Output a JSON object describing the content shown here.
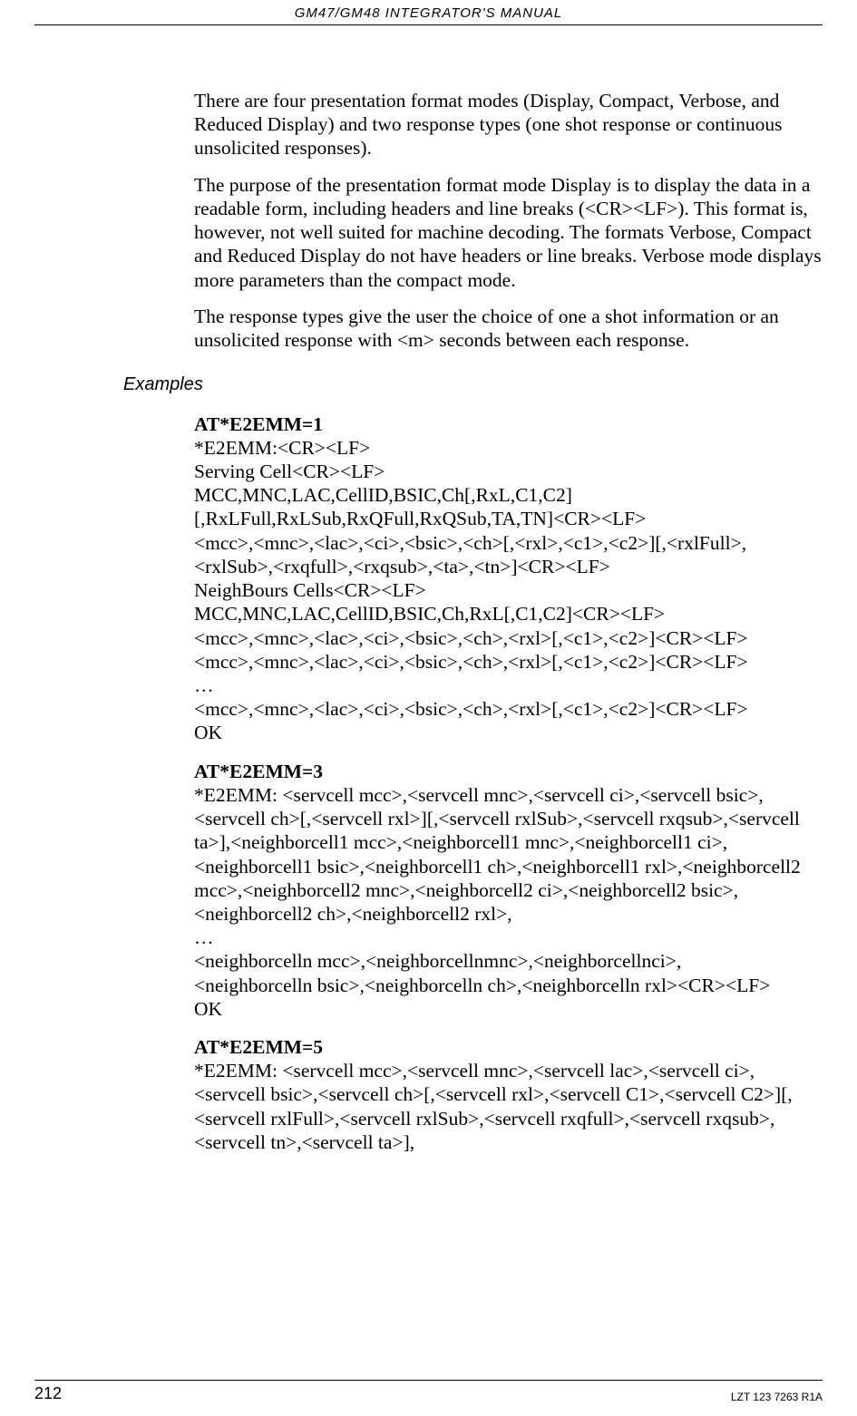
{
  "header": {
    "title": "GM47/GM48 INTEGRATOR'S MANUAL"
  },
  "body": {
    "p1": "There are four presentation format modes (Display, Compact, Verbose, and Reduced Display) and two response types (one shot response or continuous unsolicited responses).",
    "p2": "The purpose of the presentation format mode Display is to display the data in a readable form, including headers and line breaks (<CR><LF>). This format is, however, not well suited for machine decoding. The formats Verbose, Compact and Reduced Display do not have headers or line breaks. Verbose mode displays more parameters than the compact mode.",
    "p3": "The response types give the user the choice of one a shot information or an unsolicited response with <m> seconds between each response.",
    "examples_label": "Examples",
    "ex1_title": "AT*E2EMM=1",
    "ex1_body": "*E2EMM:<CR><LF>\nServing Cell<CR><LF>\nMCC,MNC,LAC,CellID,BSIC,Ch[,RxL,C1,C2][,RxLFull,RxLSub,RxQFull,RxQSub,TA,TN]<CR><LF>\n<mcc>,<mnc>,<lac>,<ci>,<bsic>,<ch>[,<rxl>,<c1>,<c2>][,<rxlFull>,<rxlSub>,<rxqfull>,<rxqsub>,<ta>,<tn>]<CR><LF>\nNeighBours Cells<CR><LF>\nMCC,MNC,LAC,CellID,BSIC,Ch,RxL[,C1,C2]<CR><LF>\n<mcc>,<mnc>,<lac>,<ci>,<bsic>,<ch>,<rxl>[,<c1>,<c2>]<CR><LF>\n<mcc>,<mnc>,<lac>,<ci>,<bsic>,<ch>,<rxl>[,<c1>,<c2>]<CR><LF>\n…\n<mcc>,<mnc>,<lac>,<ci>,<bsic>,<ch>,<rxl>[,<c1>,<c2>]<CR><LF>\nOK",
    "ex2_title": "AT*E2EMM=3",
    "ex2_body": "*E2EMM: <servcell mcc>,<servcell mnc>,<servcell ci>,<servcell bsic>,<servcell ch>[,<servcell rxl>][,<servcell rxlSub>,<servcell rxqsub>,<servcell ta>],<neighborcell1 mcc>,<neighborcell1 mnc>,<neighborcell1 ci>,<neighborcell1 bsic>,<neighborcell1 ch>,<neighborcell1 rxl>,<neighborcell2 mcc>,<neighborcell2 mnc>,<neighborcell2 ci>,<neighborcell2 bsic>,<neighborcell2 ch>,<neighborcell2 rxl>,\n…\n<neighborcelln mcc>,<neighborcellnmnc>,<neighborcellnci>,\n<neighborcelln bsic>,<neighborcelln ch>,<neighborcelln rxl><CR><LF>\nOK",
    "ex3_title": "AT*E2EMM=5",
    "ex3_body": "*E2EMM: <servcell mcc>,<servcell mnc>,<servcell lac>,<servcell ci>,<servcell bsic>,<servcell ch>[,<servcell rxl>,<servcell C1>,<servcell C2>][,<servcell rxlFull>,<servcell rxlSub>,<servcell rxqfull>,<servcell rxqsub>,<servcell tn>,<servcell ta>],"
  },
  "footer": {
    "page_number": "212",
    "doc_id": "LZT 123 7263 R1A"
  }
}
